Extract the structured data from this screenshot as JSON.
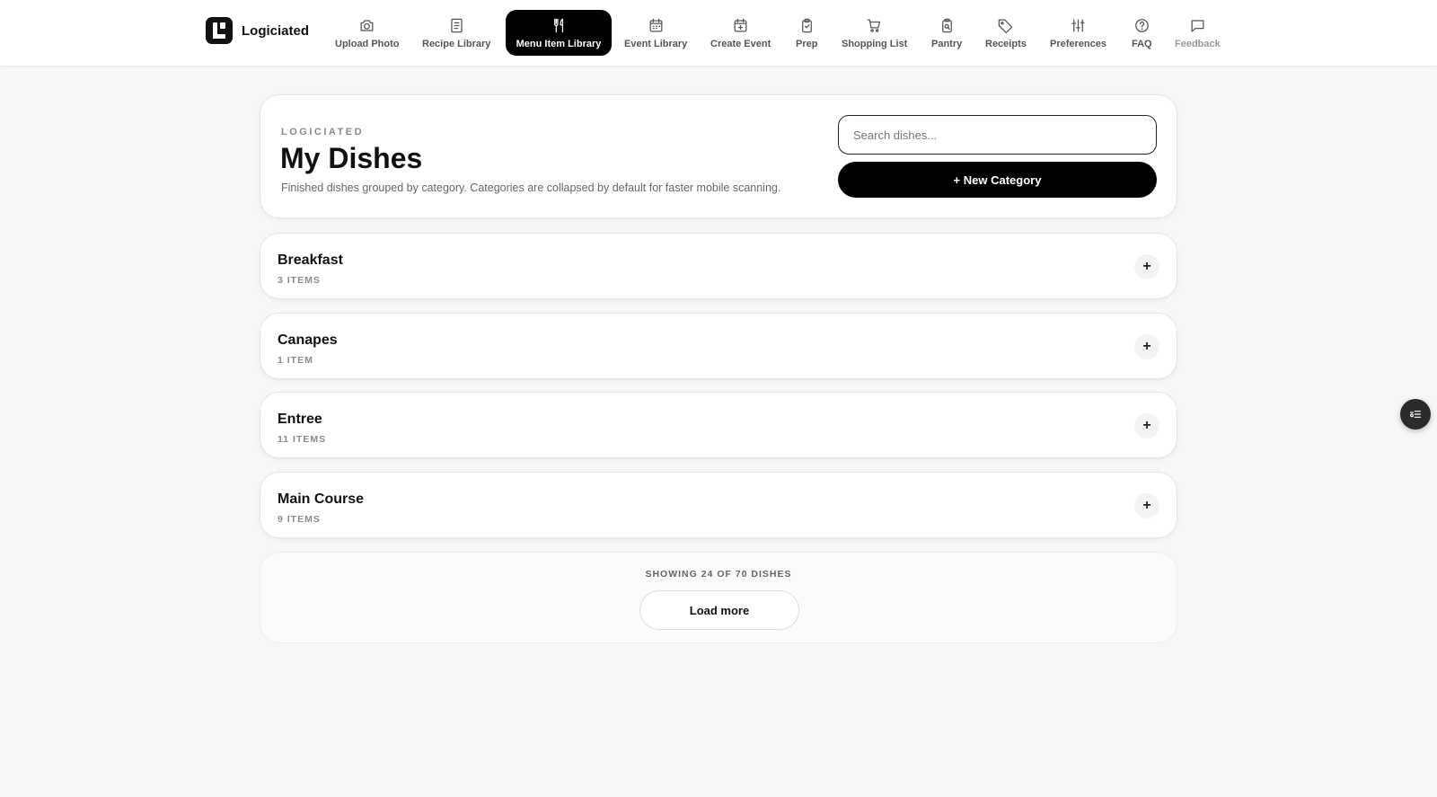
{
  "brand": {
    "name": "Logiciated",
    "icon": "logo-icon"
  },
  "nav": {
    "items": [
      {
        "label": "Upload Photo",
        "icon": "camera-icon"
      },
      {
        "label": "Recipe Library",
        "icon": "book-icon"
      },
      {
        "label": "Menu Item Library",
        "icon": "utensils-icon",
        "active": true
      },
      {
        "label": "Event Library",
        "icon": "calendar-grid-icon"
      },
      {
        "label": "Create Event",
        "icon": "calendar-plus-icon"
      },
      {
        "label": "Prep",
        "icon": "clipboard-icon"
      },
      {
        "label": "Shopping List",
        "icon": "cart-icon"
      },
      {
        "label": "Pantry",
        "icon": "jar-search-icon"
      },
      {
        "label": "Receipts",
        "icon": "tag-icon"
      },
      {
        "label": "Preferences",
        "icon": "sliders-icon"
      },
      {
        "label": "FAQ",
        "icon": "help-circle-icon"
      },
      {
        "label": "Feedback",
        "icon": "message-icon"
      }
    ],
    "active_color": "#000000"
  },
  "header": {
    "eyebrow": "LOGICIATED",
    "title": "My Dishes",
    "subtitle": "Finished dishes grouped by category. Categories are collapsed by default for faster mobile scanning.",
    "search_placeholder": "Search dishes...",
    "new_category_label": "+ New Category"
  },
  "categories": [
    {
      "name": "Breakfast",
      "count": "3 ITEMS"
    },
    {
      "name": "Canapes",
      "count": "1 ITEM"
    },
    {
      "name": "Entree",
      "count": "11 ITEMS"
    },
    {
      "name": "Main Course",
      "count": "9 ITEMS"
    }
  ],
  "toggle_symbol": "+",
  "footer": {
    "showing": "SHOWING 24 OF 70 DISHES",
    "load_more_label": "Load more"
  },
  "fab": {
    "icon": "list-settings-icon"
  }
}
